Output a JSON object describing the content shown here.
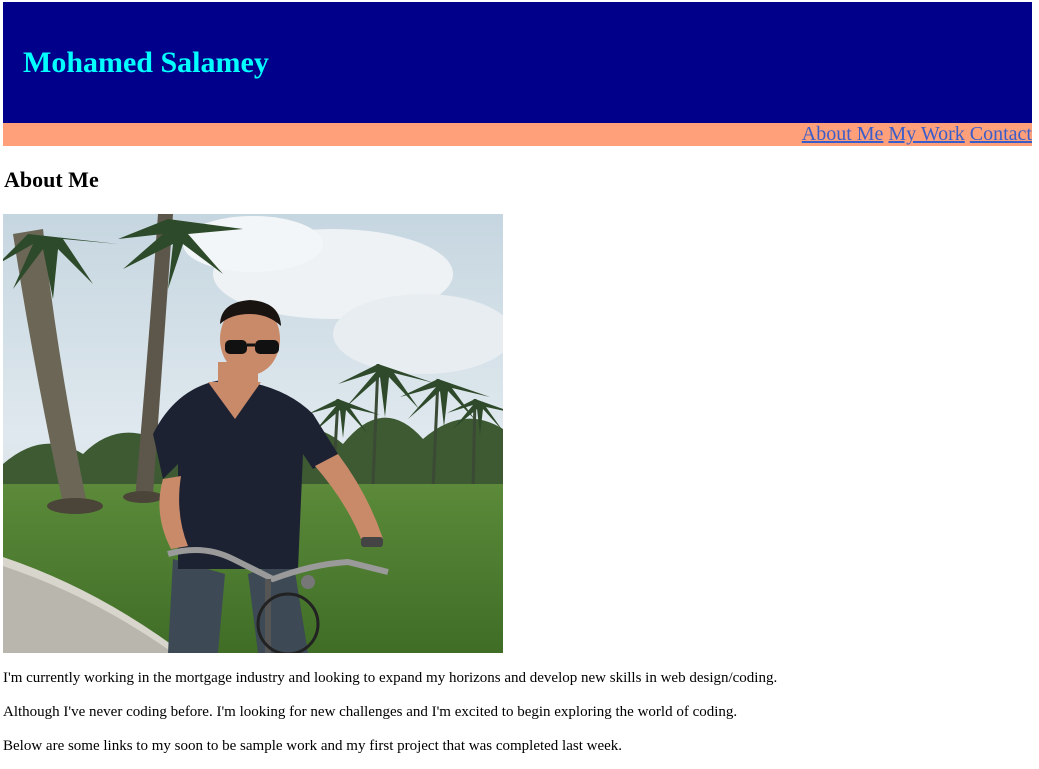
{
  "header": {
    "title": "Mohamed Salamey"
  },
  "nav": {
    "items": [
      {
        "label": "About Me"
      },
      {
        "label": "My Work"
      },
      {
        "label": "Contact"
      }
    ]
  },
  "main": {
    "heading": "About Me",
    "photo_alt": "Man in sunglasses riding a bicycle on grass near palm trees",
    "paragraphs": [
      "I'm currently working in the mortgage industry and looking to expand my horizons and develop new skills in web design/coding.",
      "Although I've never coding before. I'm looking for new challenges and I'm excited to begin exploring the world of coding.",
      "Below are some links to my soon to be sample work and my first project that was completed last week."
    ]
  },
  "colors": {
    "header_bg": "#00008b",
    "title": "#00ffff",
    "nav_bg": "#ffa07a",
    "link": "#3b5dc9"
  }
}
